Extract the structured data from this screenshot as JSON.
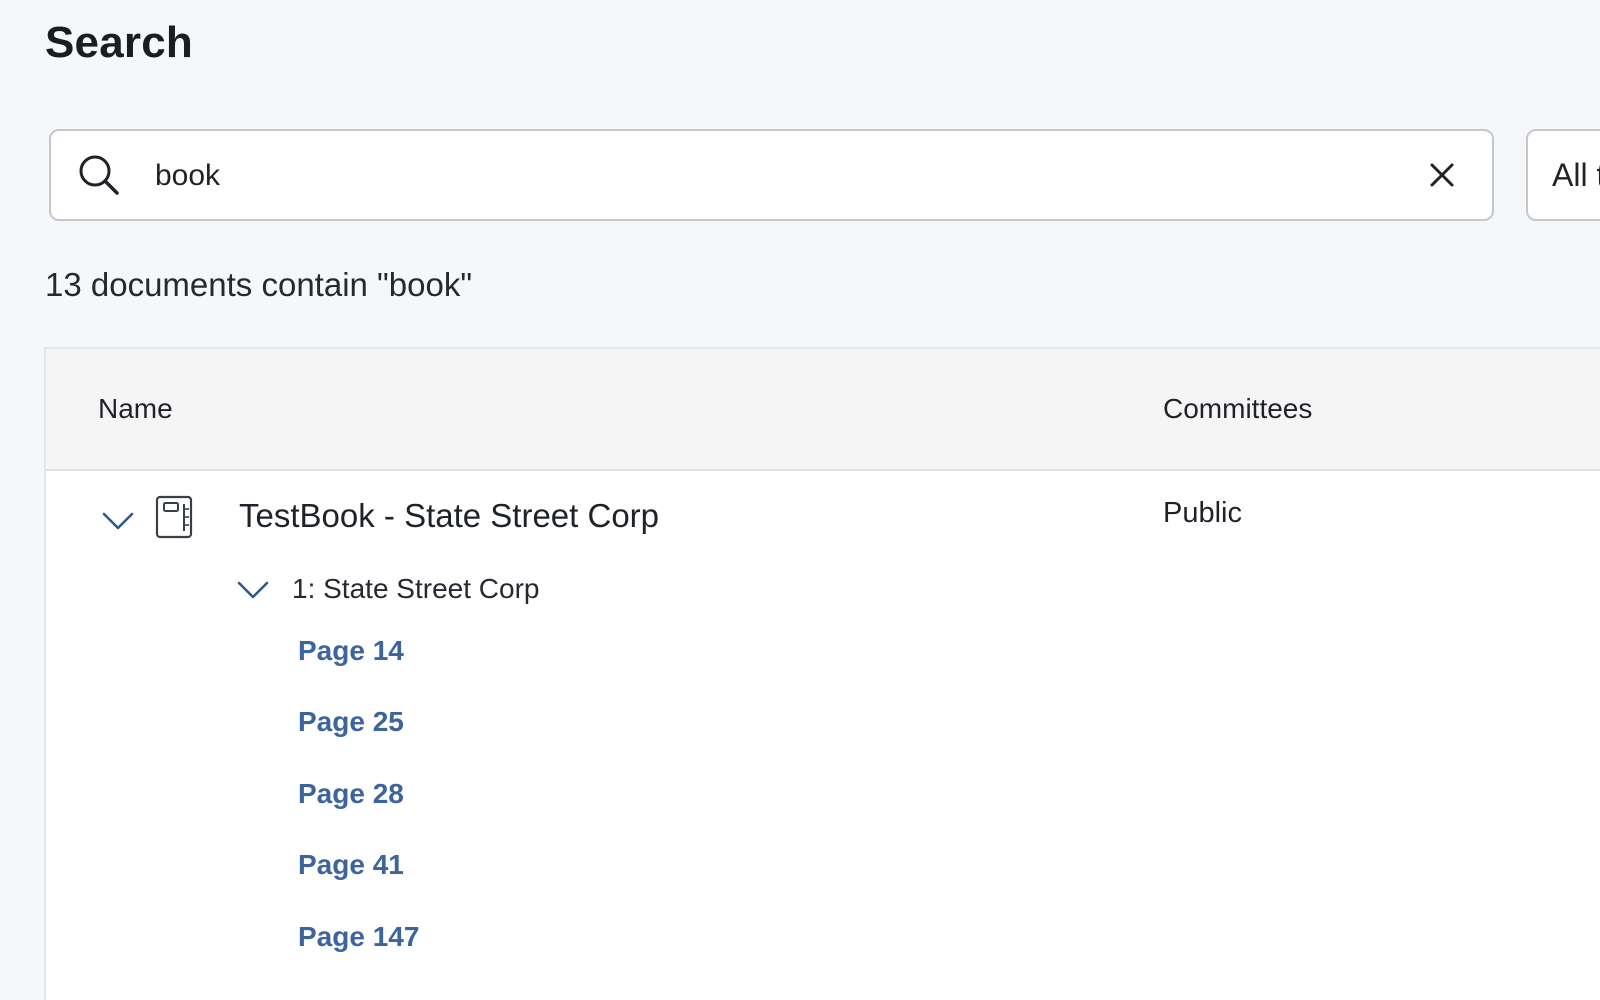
{
  "page": {
    "title": "Search"
  },
  "search": {
    "query": "book",
    "placeholder": "Search",
    "clear_label": "Clear search"
  },
  "filter": {
    "selected": "All types"
  },
  "results": {
    "summary": "13 documents contain \"book\""
  },
  "table": {
    "columns": {
      "name": "Name",
      "committees": "Committees"
    },
    "rows": [
      {
        "name": "TestBook - State Street Corp",
        "committees": "Public",
        "icon": "book-icon",
        "expanded": true,
        "sections": [
          {
            "title": "1: State Street Corp",
            "expanded": true,
            "pages": [
              "Page 14",
              "Page 25",
              "Page 28",
              "Page 41",
              "Page 147"
            ]
          }
        ]
      }
    ]
  },
  "colors": {
    "background": "#f6f7f8",
    "link": "#3d649d",
    "chevron": "#2b5a8a",
    "border": "#c4c7cb"
  }
}
